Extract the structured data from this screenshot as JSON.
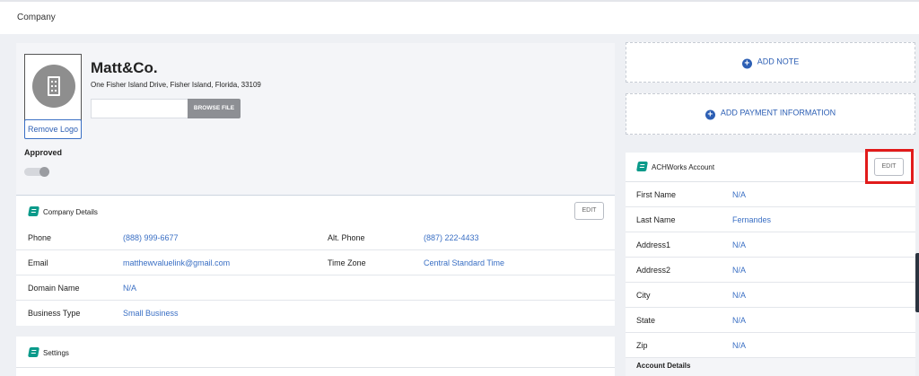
{
  "breadcrumb": "Company",
  "company": {
    "name": "Matt&Co.",
    "address": "One Fisher Island Drive, Fisher Island, Florida, 33109",
    "file_value": "",
    "browse_label": "BROWSE FILE",
    "remove_logo_label": "Remove Logo",
    "approved_label": "Approved",
    "approved_on": false
  },
  "company_details": {
    "title": "Company Details",
    "edit_label": "EDIT",
    "rows": [
      {
        "l1": "Phone",
        "v1": "(888) 999-6677",
        "l2": "Alt. Phone",
        "v2": "(887) 222-4433"
      },
      {
        "l1": "Email",
        "v1": "matthewvaluelink@gmail.com",
        "l2": "Time Zone",
        "v2": "Central Standard Time"
      },
      {
        "l1": "Domain Name",
        "v1": "N/A"
      },
      {
        "l1": "Business Type",
        "v1": "Small Business"
      }
    ]
  },
  "settings": {
    "title": "Settings"
  },
  "add_note_label": "ADD NOTE",
  "add_payment_label": "ADD PAYMENT INFORMATION",
  "achworks": {
    "title": "ACHWorks Account",
    "edit_label": "EDIT",
    "rows": [
      {
        "label": "First Name",
        "value": "N/A"
      },
      {
        "label": "Last Name",
        "value": "Fernandes"
      },
      {
        "label": "Address1",
        "value": "N/A"
      },
      {
        "label": "Address2",
        "value": "N/A"
      },
      {
        "label": "City",
        "value": "N/A"
      },
      {
        "label": "State",
        "value": "N/A"
      },
      {
        "label": "Zip",
        "value": "N/A"
      }
    ],
    "account_details_label": "Account Details"
  },
  "colors": {
    "accent": "#2d5fb4",
    "icon_teal": "#0a9a8a",
    "highlight": "#e11b1b"
  }
}
